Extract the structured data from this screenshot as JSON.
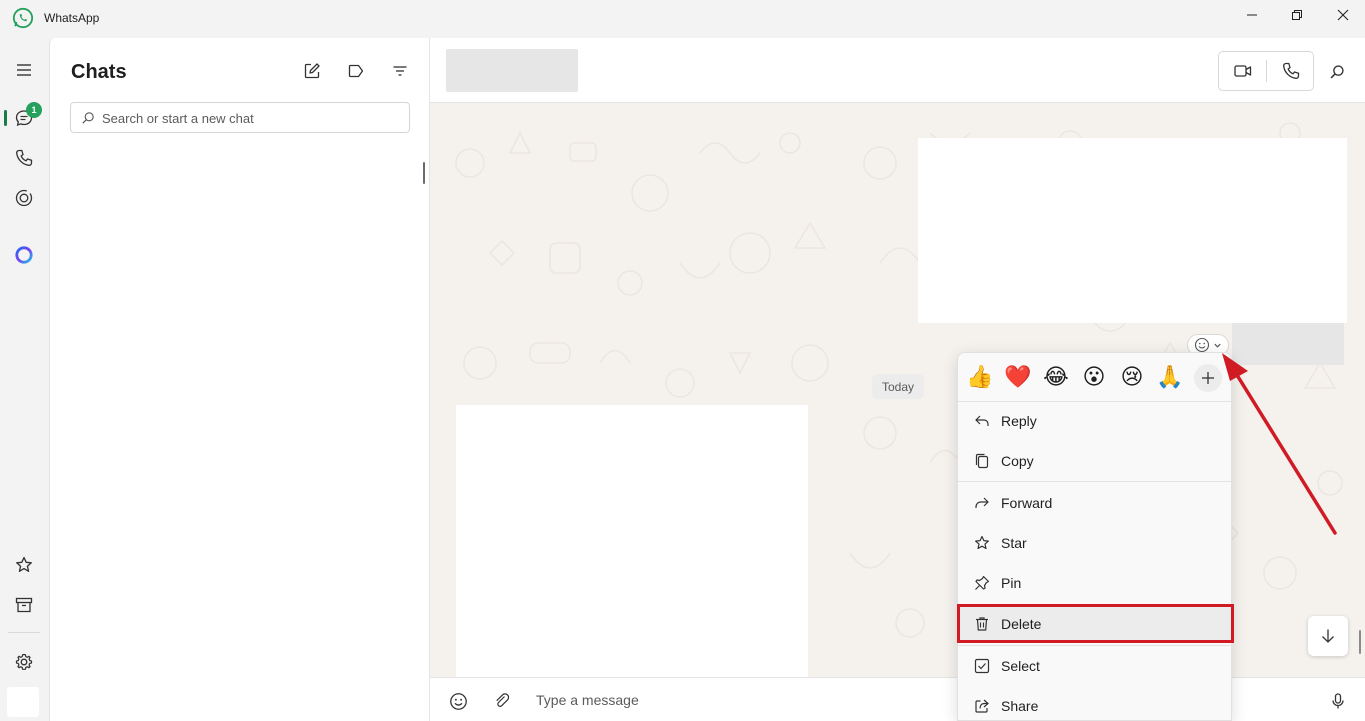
{
  "window": {
    "title": "WhatsApp",
    "brand_color": "#25a15d"
  },
  "rail": {
    "chats_badge": "1",
    "icons": [
      "menu-icon",
      "chats-icon",
      "calls-icon",
      "status-icon",
      "meta-ai-icon",
      "starred-icon",
      "archive-icon",
      "settings-icon"
    ]
  },
  "chat_list": {
    "title": "Chats",
    "search_placeholder": "Search or start a new chat"
  },
  "conversation": {
    "day_label": "Today",
    "composer_placeholder": "Type a message"
  },
  "context_menu": {
    "reactions": [
      "👍",
      "❤️",
      "😂",
      "😮",
      "😢",
      "🙏"
    ],
    "items": [
      {
        "label": "Reply",
        "icon": "reply-icon"
      },
      {
        "label": "Copy",
        "icon": "copy-icon"
      },
      {
        "label": "Forward",
        "icon": "forward-icon"
      },
      {
        "label": "Star",
        "icon": "star-icon"
      },
      {
        "label": "Pin",
        "icon": "pin-icon"
      },
      {
        "label": "Delete",
        "icon": "trash-icon"
      },
      {
        "label": "Select",
        "icon": "checkbox-icon"
      },
      {
        "label": "Share",
        "icon": "share-icon"
      }
    ],
    "highlighted_item": "Delete",
    "highlight_color": "#d01b25"
  }
}
